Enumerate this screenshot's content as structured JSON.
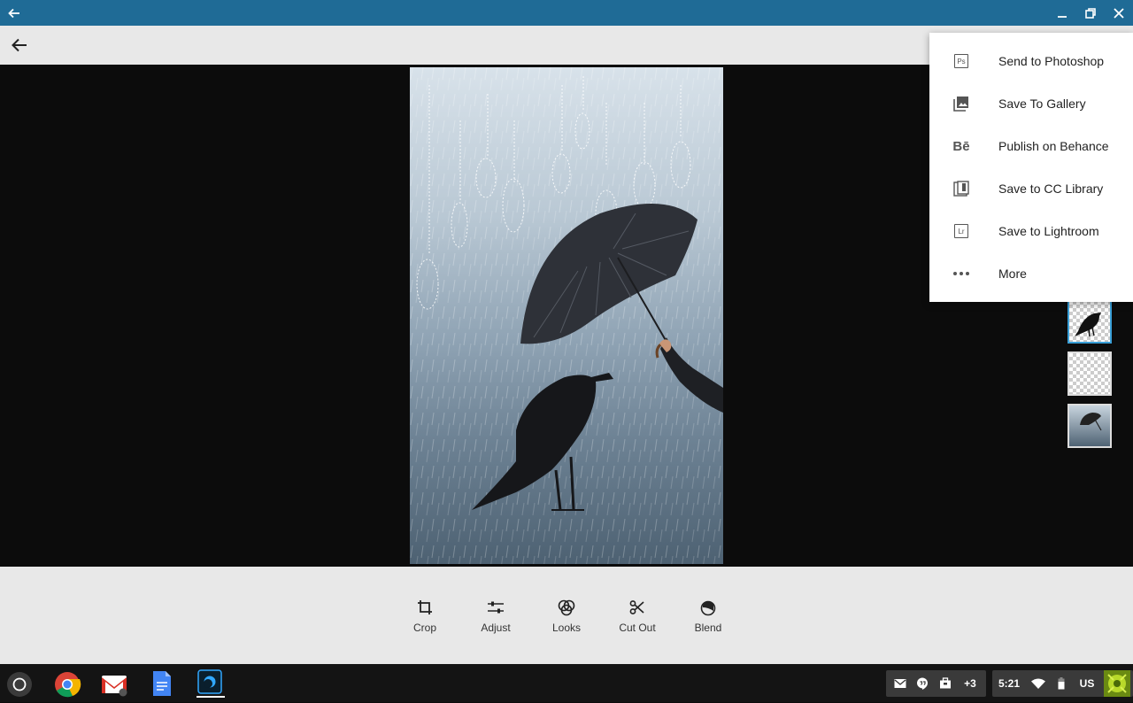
{
  "menu": {
    "items": [
      {
        "label": "Send to Photoshop",
        "icon": "photoshop-icon",
        "icon_text": "Ps"
      },
      {
        "label": "Save To Gallery",
        "icon": "gallery-icon"
      },
      {
        "label": "Publish on Behance",
        "icon": "behance-icon",
        "icon_text": "Bē"
      },
      {
        "label": "Save to CC Library",
        "icon": "cc-library-icon"
      },
      {
        "label": "Save to Lightroom",
        "icon": "lightroom-icon",
        "icon_text": "Lr"
      },
      {
        "label": "More",
        "icon": "more-icon"
      }
    ]
  },
  "tools": [
    {
      "label": "Crop",
      "icon": "crop-icon"
    },
    {
      "label": "Adjust",
      "icon": "adjust-icon"
    },
    {
      "label": "Looks",
      "icon": "looks-icon"
    },
    {
      "label": "Cut Out",
      "icon": "scissors-icon"
    },
    {
      "label": "Blend",
      "icon": "blend-icon"
    }
  ],
  "taskbar": {
    "notification_count": "+3",
    "time": "5:21",
    "input_method": "US"
  },
  "colors": {
    "titlebar": "#1f6b96",
    "selected_layer": "#3aa0d8",
    "canvas_bg": "#0c0c0c",
    "toolbar_bg": "#e8e8e8"
  }
}
